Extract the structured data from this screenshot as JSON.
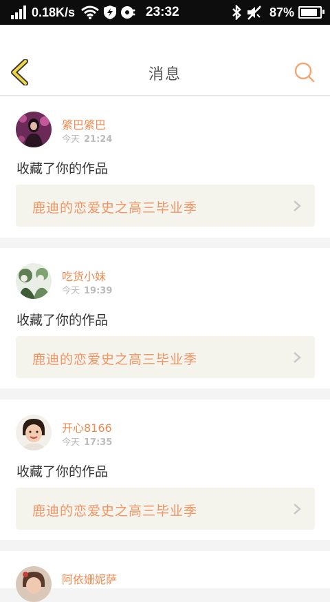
{
  "status_bar": {
    "network_speed": "0.18K/s",
    "time": "23:32",
    "battery": "87%",
    "battery_level": 0.87
  },
  "header": {
    "title": "消息"
  },
  "messages": [
    {
      "username": "綮巴綮巴",
      "day": "今天",
      "time": "21:24",
      "action": "收藏了你的作品",
      "work_title": "鹿迪的恋爱史之高三毕业季"
    },
    {
      "username": "吃货小妹",
      "day": "今天",
      "time": "19:39",
      "action": "收藏了你的作品",
      "work_title": "鹿迪的恋爱史之高三毕业季"
    },
    {
      "username": "开心8166",
      "day": "今天",
      "time": "17:35",
      "action": "收藏了你的作品",
      "work_title": "鹿迪的恋爱史之高三毕业季"
    },
    {
      "username": "阿依姗妮萨",
      "day": "",
      "time": "",
      "action": "",
      "work_title": ""
    }
  ],
  "colors": {
    "accent": "#ee8a4f",
    "back_arrow_fill": "#f2d544",
    "card_link_bg": "#f4f3ec"
  }
}
